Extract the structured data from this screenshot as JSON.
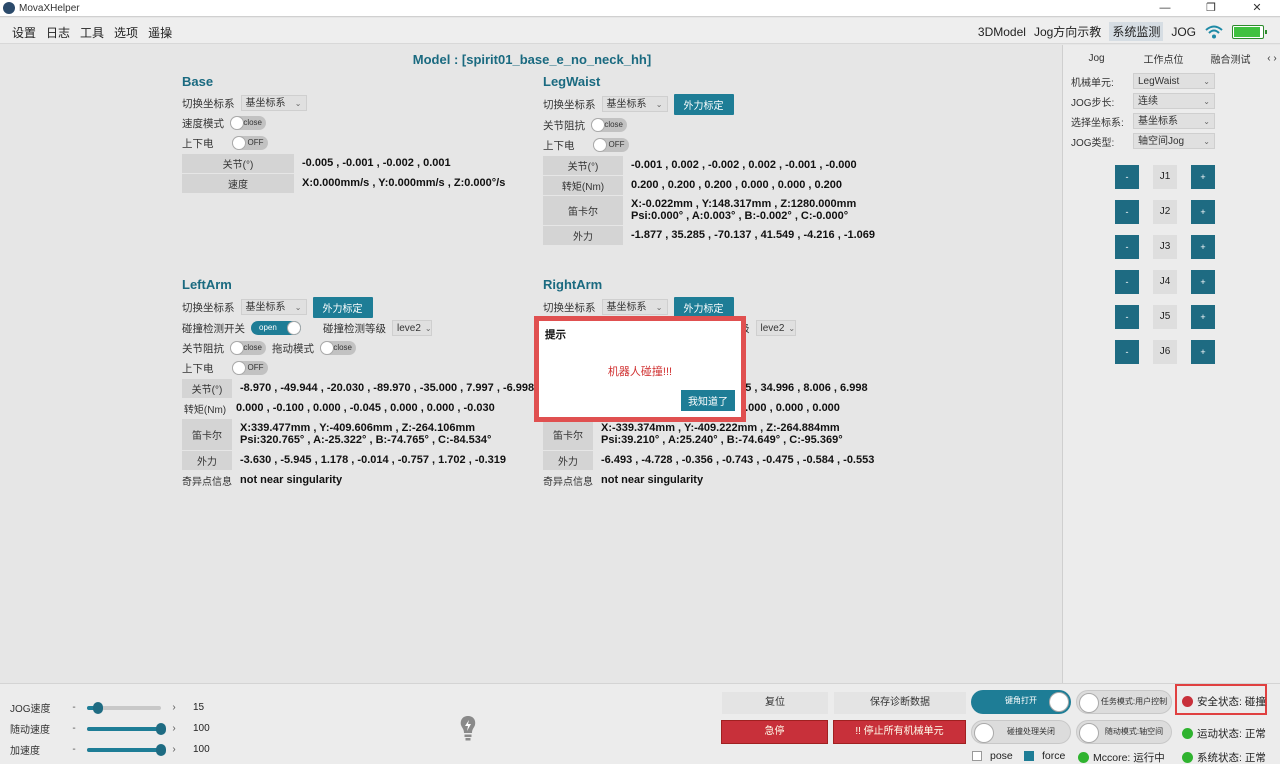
{
  "window": {
    "title": "MovaXHelper",
    "controls": [
      "—",
      "❐",
      "✕"
    ]
  },
  "menu": {
    "left": [
      "设置",
      "日志",
      "工具",
      "选项",
      "遥操"
    ],
    "right": [
      "3DModel",
      "Jog方向示教",
      "系统监测",
      "JOG"
    ],
    "active_index": 2,
    "battery_level": 0.85,
    "battery_text": "100%"
  },
  "model_title": "Model : [spirit01_base_e_no_neck_hh]",
  "base": {
    "title": "Base",
    "coord_label": "切换坐标系",
    "coord_value": "基坐标系",
    "speed_mode_label": "速度模式",
    "speed_mode_state": "close",
    "power_label": "上下电",
    "power_state": "OFF",
    "joint_key": "关节(°)",
    "joint_val": "-0.005 , -0.001 , -0.002 , 0.001",
    "speed_key": "速度",
    "speed_val": "X:0.000mm/s , Y:0.000mm/s , Z:0.000°/s"
  },
  "legwaist": {
    "title": "LegWaist",
    "coord_label": "切换坐标系",
    "coord_value": "基坐标系",
    "calib": "外力标定",
    "imp_label": "关节阻抗",
    "imp_state": "close",
    "power_label": "上下电",
    "power_state": "OFF",
    "joint_key": "关节(°)",
    "joint_val": "-0.001 , 0.002 , -0.002 , 0.002 , -0.001 , -0.000",
    "torque_key": "转矩(Nm)",
    "torque_val": "0.200 , 0.200 , 0.200 , 0.000 , 0.000 , 0.200",
    "cart_key": "笛卡尔",
    "cart_val1": "X:-0.022mm , Y:148.317mm , Z:1280.000mm",
    "cart_val2": "Psi:0.000° , A:0.003° , B:-0.002° , C:-0.000°",
    "force_key": "外力",
    "force_val": "-1.877 , 35.285 , -70.137 , 41.549 , -4.216 , -1.069"
  },
  "leftarm": {
    "title": "LeftArm",
    "coord_label": "切换坐标系",
    "coord_value": "基坐标系",
    "calib": "外力标定",
    "col_label": "碰撞检测开关",
    "col_state": "open",
    "col_level_label": "碰撞检测等级",
    "col_level": "leve2",
    "imp_label": "关节阻抗",
    "imp_state": "close",
    "drag_label": "拖动模式",
    "drag_state": "close",
    "power_label": "上下电",
    "power_state": "OFF",
    "joint_key": "关节(°)",
    "joint_val": "-8.970 , -49.944 , -20.030 , -89.970 , -35.000 , 7.997 , -6.998",
    "torque_key": "转矩(Nm)",
    "torque_val": "0.000 , -0.100 , 0.000 , -0.045 , 0.000 , 0.000 , -0.030",
    "cart_key": "笛卡尔",
    "cart_val1": "X:339.477mm , Y:-409.606mm , Z:-264.106mm",
    "cart_val2": "Psi:320.765° , A:-25.322° , B:-74.765° , C:-84.534°",
    "force_key": "外力",
    "force_val": "-3.630 , -5.945 , 1.178 , -0.014 , -0.757 , 1.702 , -0.319",
    "sing_key": "奇异点信息",
    "sing_val": "not near singularity"
  },
  "rightarm": {
    "title": "RightArm",
    "coord_label": "切换坐标系",
    "coord_value": "基坐标系",
    "calib": "外力标定",
    "col_level_partial": "级",
    "col_level": "leve2",
    "joint_val_partial": "955 , 34.996 , 8.006 , 6.998",
    "torque_val_partial": "0.000 , 0.000 , 0.000",
    "cart_key": "笛卡尔",
    "cart_val1": "X:-339.374mm , Y:-409.222mm , Z:-264.884mm",
    "cart_val2": "Psi:39.210° , A:25.240° , B:-74.649° , C:-95.369°",
    "force_key": "外力",
    "force_val": "-6.493 , -4.728 , -0.356 , -0.743 , -0.475 , -0.584 , -0.553",
    "sing_key": "奇异点信息",
    "sing_val": "not near singularity"
  },
  "dialog": {
    "title": "提示",
    "message": "机器人碰撞!!!",
    "ok": "我知道了"
  },
  "side": {
    "tabs": [
      "Jog",
      "工作点位",
      "融合测试"
    ],
    "unit_label": "机械单元:",
    "unit_value": "LegWaist",
    "step_label": "JOG步长:",
    "step_value": "连续",
    "coord_label": "选择坐标系:",
    "coord_value": "基坐标系",
    "type_label": "JOG类型:",
    "type_value": "轴空间Jog",
    "joints": [
      "J1",
      "J2",
      "J3",
      "J4",
      "J5",
      "J6"
    ],
    "minus": "-",
    "plus": "+"
  },
  "bottom": {
    "sliders": [
      {
        "label": "JOG速度",
        "value": "15",
        "fraction": 0.15
      },
      {
        "label": "随动速度",
        "value": "100",
        "fraction": 1.0
      },
      {
        "label": "加速度",
        "value": "100",
        "fraction": 1.0
      }
    ],
    "reset": "复位",
    "save_diag": "保存诊断数据",
    "estop": "急停",
    "stop_all": "!! 停止所有机械单元",
    "handle_open": "键角打开",
    "task_mode": "任务模式:用户控制",
    "collision_off": "碰撞处理关闭",
    "follow_mode": "随动模式:轴空间",
    "radio_pose": "pose",
    "radio_force": "force",
    "mccore": "Mccore: 运行中",
    "safety": "安全状态: 碰撞",
    "motion": "运动状态: 正常",
    "system": "系统状态: 正常",
    "colors": {
      "danger": "#c8303a",
      "ok": "#2fb32f",
      "accent": "#1e7d96"
    }
  }
}
